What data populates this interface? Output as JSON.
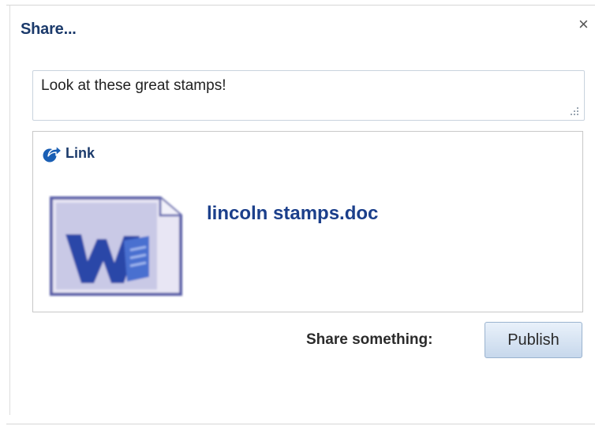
{
  "dialog": {
    "title": "Share...",
    "close_glyph": "×",
    "close_icon": "close-icon"
  },
  "message": {
    "value": "Look at these great stamps!"
  },
  "link_panel": {
    "label": "Link",
    "icon": "share-arrow-icon",
    "document": {
      "name": "lincoln stamps.doc",
      "icon": "word-document-icon"
    }
  },
  "footer": {
    "share_label": "Share something:",
    "publish_label": "Publish"
  },
  "colors": {
    "title": "#1b3a6b",
    "link": "#1b3f8b",
    "button_top": "#e9f1fa",
    "button_bottom": "#c7d8ec"
  }
}
